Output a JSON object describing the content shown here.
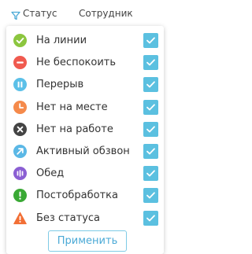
{
  "header": {
    "filter_icon": "funnel-icon",
    "status_label": "Статус",
    "employee_label": "Сотрудник"
  },
  "statuses": [
    {
      "label": "На линии",
      "icon": "check-circle-icon",
      "color": "#8cc63f",
      "checked": true
    },
    {
      "label": "Не беспокоить",
      "icon": "minus-circle-icon",
      "color": "#f05a4f",
      "checked": true
    },
    {
      "label": "Перерыв",
      "icon": "pause-circle-icon",
      "color": "#5bc0e8",
      "checked": true
    },
    {
      "label": "Нет на месте",
      "icon": "clock-circle-icon",
      "color": "#f58a4b",
      "checked": true
    },
    {
      "label": "Нет на работе",
      "icon": "x-circle-icon",
      "color": "#444444",
      "checked": true
    },
    {
      "label": "Активный обзвон",
      "icon": "arrow-up-right-circle-icon",
      "color": "#5bb8e6",
      "checked": true
    },
    {
      "label": "Обед",
      "icon": "bars-circle-icon",
      "color": "#8b5fd3",
      "checked": true
    },
    {
      "label": "Постобработка",
      "icon": "exclamation-circle-icon",
      "color": "#3aa935",
      "checked": true
    },
    {
      "label": "Без статуса",
      "icon": "warning-triangle-icon",
      "color": "#f26f35",
      "checked": true
    }
  ],
  "checkbox_color": "#5bc0e0",
  "apply_button": {
    "label": "Применить"
  }
}
